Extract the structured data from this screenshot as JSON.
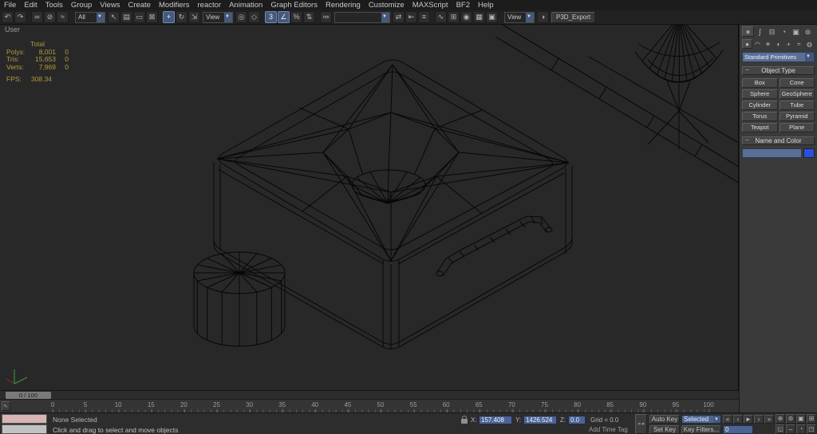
{
  "menu": {
    "items": [
      "File",
      "Edit",
      "Tools",
      "Group",
      "Views",
      "Create",
      "Modifiers",
      "reactor",
      "Animation",
      "Graph Editors",
      "Rendering",
      "Customize",
      "MAXScript",
      "BF2",
      "Help"
    ]
  },
  "toolbar": {
    "items": [
      {
        "icon": "undo"
      },
      {
        "icon": "redo"
      },
      {
        "sep": true
      },
      {
        "icon": "select-and-link"
      },
      {
        "icon": "unlink-selection"
      },
      {
        "icon": "bind-to-space-warp"
      },
      {
        "sep": true
      },
      {
        "dropdown": "selection-filter",
        "value": "All"
      },
      {
        "icon": "select-object"
      },
      {
        "icon": "select-by-name"
      },
      {
        "icon": "rectangular-selection-region"
      },
      {
        "icon": "window-crossing-toggle"
      },
      {
        "sep": true
      },
      {
        "icon": "select-and-move",
        "active": true
      },
      {
        "icon": "select-and-rotate"
      },
      {
        "icon": "select-and-uniform-scale"
      },
      {
        "dropdown": "reference-coordinate-system",
        "value": "View"
      },
      {
        "icon": "use-pivot-point-center"
      },
      {
        "icon": "select-and-manipulate"
      },
      {
        "sep": true
      },
      {
        "icon": "snaps-toggle",
        "active": true
      },
      {
        "icon": "angle-snap-toggle",
        "active": true
      },
      {
        "icon": "percent-snap-toggle"
      },
      {
        "icon": "spinner-snap-toggle"
      },
      {
        "sep": true
      },
      {
        "icon": "edit-named-selection-sets"
      },
      {
        "dropdown": "named-selection-sets",
        "value": "",
        "wide": true
      },
      {
        "icon": "mirror"
      },
      {
        "icon": "align"
      },
      {
        "icon": "layer-manager"
      },
      {
        "sep": true
      },
      {
        "icon": "curve-editor"
      },
      {
        "icon": "schematic-view"
      },
      {
        "icon": "material-editor"
      },
      {
        "icon": "render-setup"
      },
      {
        "icon": "rendered-frame-window"
      },
      {
        "sep": true
      },
      {
        "dropdown": "render-preset",
        "value": "View"
      },
      {
        "icon": "quick-render"
      },
      {
        "button": "p3d-export",
        "label": "P3D_Export"
      }
    ]
  },
  "viewport": {
    "label": "User",
    "stats": {
      "total_header": "Total",
      "rows": [
        {
          "label": "Polys:",
          "value": "8,001",
          "delta": "0"
        },
        {
          "label": "Tris:",
          "value": "15,653",
          "delta": "0"
        },
        {
          "label": "Verts:",
          "value": "7,969",
          "delta": "0"
        }
      ],
      "fps_label": "FPS:",
      "fps_value": "308.34"
    }
  },
  "command_panel": {
    "tabs": [
      "create",
      "modify",
      "hierarchy",
      "motion",
      "display",
      "utilities"
    ],
    "categories": [
      "geometry",
      "shapes",
      "lights",
      "cameras",
      "helpers",
      "space-warps",
      "systems"
    ],
    "primitive_dropdown": "Standard Primitives",
    "object_type_rollout": "Object Type",
    "object_type_buttons": [
      "Box",
      "Cone",
      "Sphere",
      "GeoSphere",
      "Cylinder",
      "Tube",
      "Torus",
      "Pyramid",
      "Teapot",
      "Plane"
    ],
    "name_color_rollout": "Name and Color",
    "object_name": "",
    "object_color": "#2b50e0"
  },
  "timeline": {
    "slider_label": "0 / 100",
    "ticks": [
      "0",
      "5",
      "10",
      "15",
      "20",
      "25",
      "30",
      "35",
      "40",
      "45",
      "50",
      "55",
      "60",
      "65",
      "70",
      "75",
      "80",
      "85",
      "90",
      "95",
      "100"
    ]
  },
  "status_bar": {
    "selection_status": "None Selected",
    "prompt": "Click and drag to select and move objects",
    "add_time_tag": "Add Time Tag",
    "x_label": "X:",
    "x_value": "157.408",
    "y_label": "Y:",
    "y_value": "1426.524",
    "z_label": "Z:",
    "z_value": "0.0",
    "grid": "Grid = 0.0",
    "auto_key": "Auto Key",
    "set_key": "Set Key",
    "selected_dropdown": "Selected",
    "key_filters": "Key Filters...",
    "frame_field": "0",
    "playback": [
      "go-to-start",
      "previous-frame",
      "play-animation",
      "next-frame",
      "go-to-end"
    ],
    "nav": [
      "zoom",
      "zoom-all",
      "zoom-extents",
      "zoom-extents-all",
      "zoom-region",
      "pan",
      "arc-rotate",
      "maximize-viewport-toggle"
    ]
  }
}
